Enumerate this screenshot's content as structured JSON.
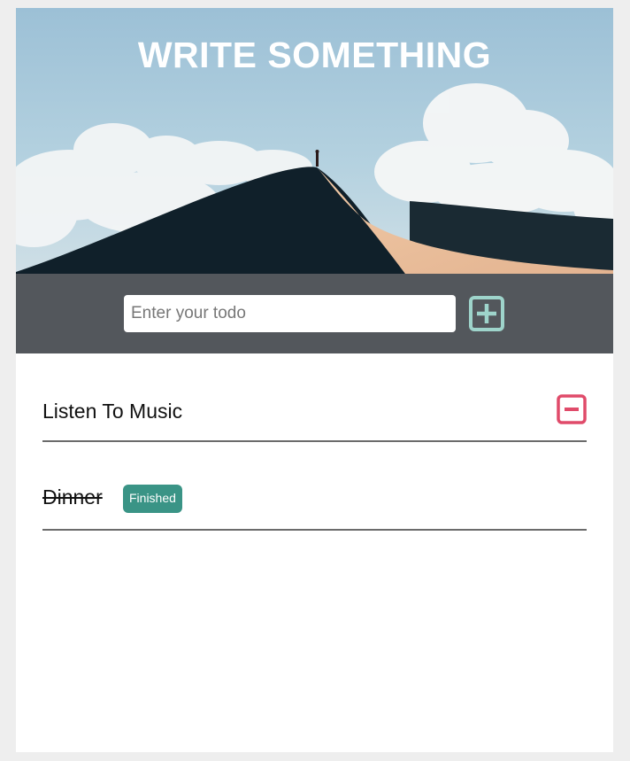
{
  "header": {
    "title": "WRITE SOMETHING"
  },
  "input": {
    "placeholder": "Enter your todo",
    "value": ""
  },
  "todos": [
    {
      "label": "Listen To Music",
      "finished": false
    },
    {
      "label": "Dinner",
      "finished": true,
      "badge": "Finished"
    }
  ],
  "colors": {
    "accent_add": "#9ed4cb",
    "accent_remove": "#e04b6a",
    "badge": "#3a9486",
    "input_bar": "#53575c"
  },
  "icons": {
    "add": "plus-square-icon",
    "remove": "minus-square-icon"
  }
}
